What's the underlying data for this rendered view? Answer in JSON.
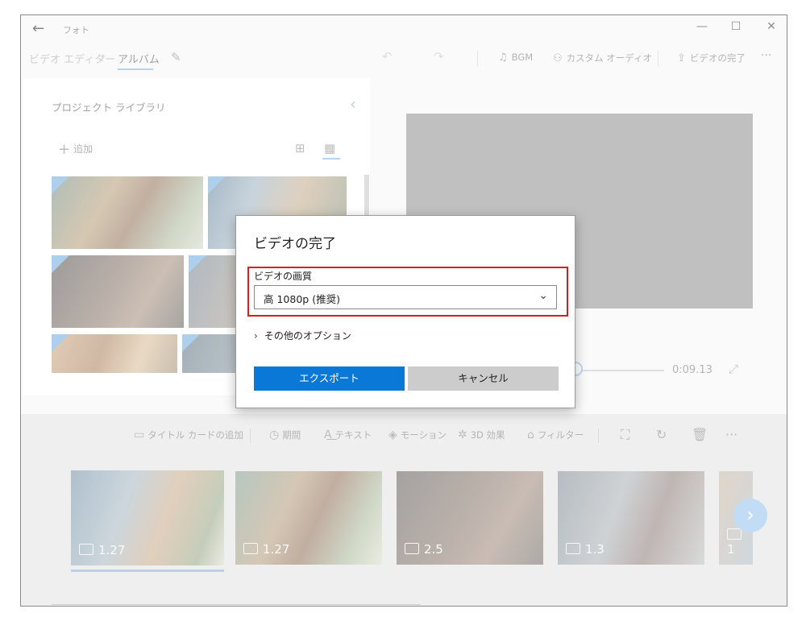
{
  "titlebar": {
    "back_glyph": "←",
    "app_name": "フォト",
    "minimize_glyph": "—",
    "maximize_glyph": "☐",
    "close_glyph": "✕"
  },
  "commandbar": {
    "breadcrumb_parent": "ビデオ エディター",
    "breadcrumb_separator": "›",
    "breadcrumb_current": "アルバム",
    "edit_icon": "✎",
    "undo_icon": "↶",
    "redo_icon": "↷",
    "bgm_label": "BGM",
    "bgm_icon": "♫",
    "custom_audio_label": "カスタム オーディオ",
    "custom_audio_icon": "⚇",
    "finish_label": "ビデオの完了",
    "finish_icon": "⇪",
    "more_icon": "···"
  },
  "library": {
    "title": "プロジェクト ライブラリ",
    "collapse_icon": "‹",
    "add_label": "追加",
    "add_icon": "+",
    "view_icon_large": "⊞",
    "view_icon_small": "▦"
  },
  "preview": {
    "time": "0:09.13",
    "fullscreen_icon": "⤢"
  },
  "storyboard": {
    "tools": {
      "title_card": "タイトル カードの追加",
      "duration": "期間",
      "text": "テキスト",
      "motion": "モーション",
      "effects_3d": "3D 効果",
      "filters": "フィルター"
    },
    "tool_icons": {
      "title_card": "▭",
      "duration": "◷",
      "text": "A͟",
      "motion": "◈",
      "effects_3d": "✲",
      "filters": "⌂",
      "resize": "⛶",
      "rotate": "↻",
      "delete": "🗑",
      "more": "···"
    },
    "clips": [
      {
        "duration": "1.27"
      },
      {
        "duration": "1.27"
      },
      {
        "duration": "2.5"
      },
      {
        "duration": "1.3"
      },
      {
        "duration": "1"
      }
    ],
    "next_icon": "›"
  },
  "dialog": {
    "title": "ビデオの完了",
    "quality_label": "ビデオの画質",
    "quality_value": "高 1080p (推奨)",
    "chevron": "⌄",
    "more_options": "その他のオプション",
    "more_chevron": "›",
    "export_label": "エクスポート",
    "cancel_label": "キャンセル"
  },
  "colors": {
    "accent": "#0a78d7",
    "highlight_box": "#d42020",
    "selection": "#7fb0d8"
  }
}
